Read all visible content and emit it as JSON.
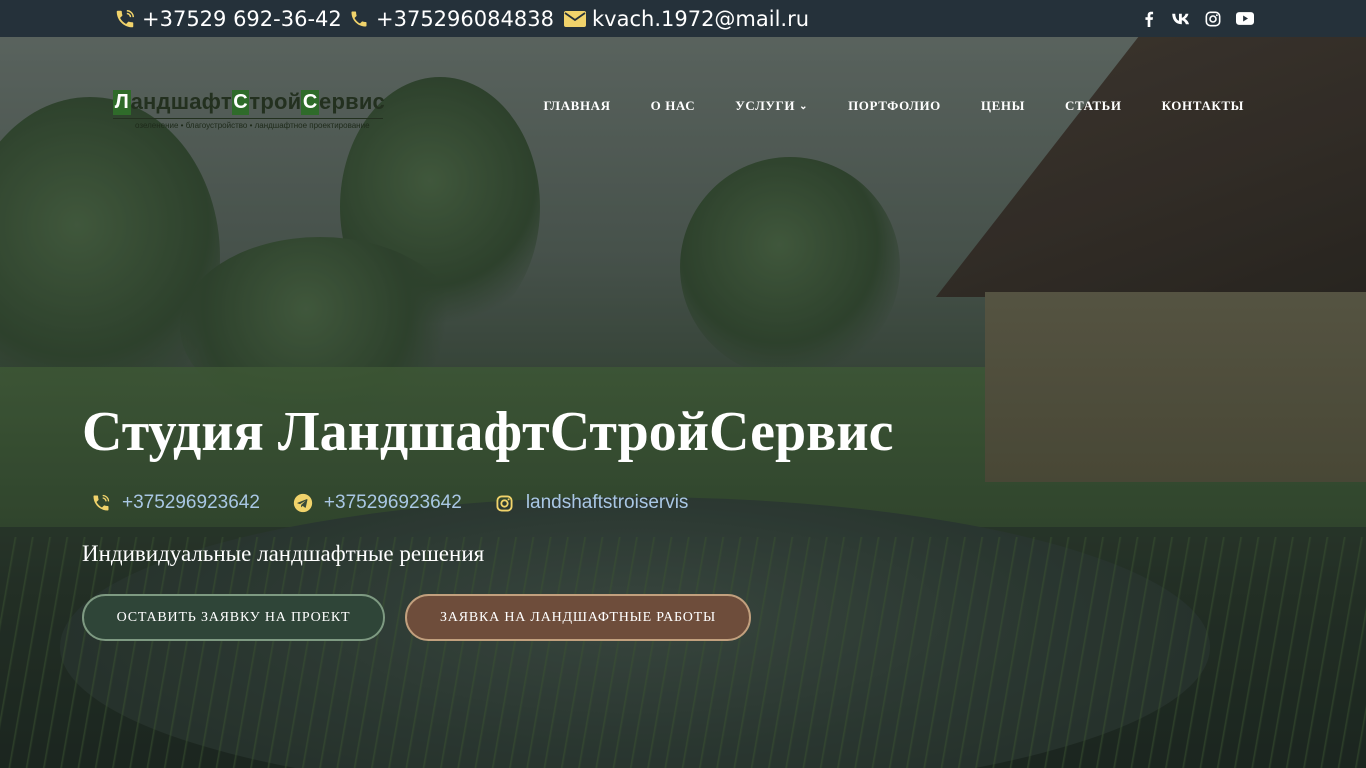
{
  "topbar": {
    "phone1": "+37529 692-36-42",
    "phone2": "+375296084838",
    "email": "kvach.1972@mail.ru",
    "social": [
      "facebook-icon",
      "vk-icon",
      "instagram-icon",
      "youtube-icon"
    ]
  },
  "logo": {
    "cap1": "Л",
    "part1": "андшафт",
    "cap2": "С",
    "part2": "трой",
    "cap3": "С",
    "part3": "ервис",
    "tagline": "озеленение • благоустройство • ландшафтное проектирование"
  },
  "nav": {
    "items": [
      "ГЛАВНАЯ",
      "О НАС",
      "УСЛУГИ",
      "ПОРТФОЛИО",
      "ЦЕНЫ",
      "СТАТЬИ",
      "КОНТАКТЫ"
    ]
  },
  "hero": {
    "title": "Студия ЛандшафтСтройСервис",
    "viber": "+375296923642",
    "telegram": "+375296923642",
    "instagram": "landshaftstroiservis",
    "subtitle": "Индивидуальные ландшафтные решения",
    "button1": "ОСТАВИТЬ ЗАЯВКУ НА ПРОЕКТ",
    "button2": "ЗАЯВКА НА ЛАНДШАФТНЫЕ РАБОТЫ"
  },
  "colors": {
    "topbar": "#25313a",
    "link": "#a9c7e4",
    "icon_accent": "#f1d36b",
    "button1": "#2f4538",
    "button2": "#6e4d3b"
  }
}
